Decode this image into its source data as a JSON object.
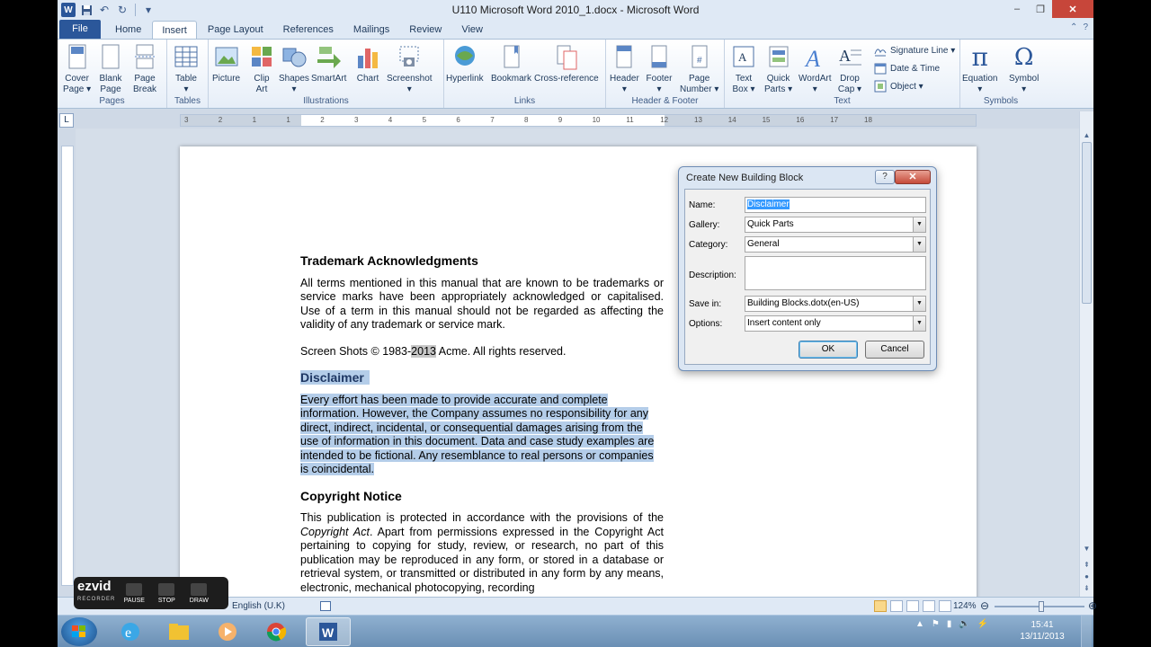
{
  "window": {
    "title": "U110 Microsoft Word 2010_1.docx - Microsoft Word",
    "minimize": "–",
    "restore": "❐",
    "close": "✕"
  },
  "qat": {
    "word": "W",
    "save": "💾",
    "undo": "↶",
    "redo": "↻"
  },
  "tabs": {
    "file": "File",
    "items": [
      "Home",
      "Insert",
      "Page Layout",
      "References",
      "Mailings",
      "Review",
      "View"
    ]
  },
  "ribbon": {
    "pages": {
      "label": "Pages",
      "cover": "Cover\nPage ▾",
      "blank": "Blank\nPage",
      "break": "Page\nBreak"
    },
    "tables": {
      "label": "Tables",
      "table": "Table\n▾"
    },
    "illustrations": {
      "label": "Illustrations",
      "picture": "Picture",
      "clipart": "Clip\nArt",
      "shapes": "Shapes\n▾",
      "smartart": "SmartArt",
      "chart": "Chart",
      "screenshot": "Screenshot\n▾"
    },
    "links": {
      "label": "Links",
      "hyperlink": "Hyperlink",
      "bookmark": "Bookmark",
      "crossref": "Cross-reference"
    },
    "headerfooter": {
      "label": "Header & Footer",
      "header": "Header\n▾",
      "footer": "Footer\n▾",
      "pagenum": "Page\nNumber ▾"
    },
    "text": {
      "label": "Text",
      "textbox": "Text\nBox ▾",
      "quickparts": "Quick\nParts ▾",
      "wordart": "WordArt\n▾",
      "dropcap": "Drop\nCap ▾",
      "sigline": "Signature Line ▾",
      "datetime": "Date & Time",
      "object": "Object ▾"
    },
    "symbols": {
      "label": "Symbols",
      "equation": "Equation\n▾",
      "symbol": "Symbol\n▾"
    }
  },
  "ruler": {
    "tab_selector": "L",
    "numbers": [
      "3",
      "2",
      "1",
      "1",
      "2",
      "3",
      "4",
      "5",
      "6",
      "7",
      "8",
      "9",
      "10",
      "11",
      "12",
      "13",
      "14",
      "15",
      "16",
      "17",
      "18"
    ]
  },
  "document": {
    "h1": "Trademark Acknowledgments",
    "p1": "All terms mentioned in this manual that are known to be trademarks or service marks have been appropriately acknowledged or capitalised.  Use of a term in this manual should not be regarded as affecting the validity of any trademark or service mark.",
    "p2_a": "Screen Shots © 1983-",
    "p2_year": "2013",
    "p2_b": " Acme. All rights reserved.",
    "h2": "Disclaimer",
    "p3": "Every effort has been made to provide accurate and complete information. However, the Company assumes no responsibility for any direct, indirect, incidental, or consequential damages arising from the use of information in this document. Data and case study examples are intended to be fictional. Any resemblance to real persons or companies is coincidental.",
    "h3": "Copyright Notice",
    "p4_a": "This publication is protected in accordance with the provisions of the ",
    "p4_italic": "Copyright Act",
    "p4_b": ". Apart from permissions expressed in the Copyright Act pertaining to copying for study, review, or research, no part of this publication may be reproduced in any form, or stored in a database or retrieval system, or transmitted or distributed in any form by any means, electronic, mechanical photocopying, recording"
  },
  "dialog": {
    "title": "Create New Building Block",
    "help": "?",
    "close": "✕",
    "name_label": "Name:",
    "name_value": "Disclaimer",
    "gallery_label": "Gallery:",
    "gallery_value": "Quick Parts",
    "category_label": "Category:",
    "category_value": "General",
    "description_label": "Description:",
    "description_value": "",
    "savein_label": "Save in:",
    "savein_value": "Building Blocks.dotx(en-US)",
    "options_label": "Options:",
    "options_value": "Insert content only",
    "ok": "OK",
    "cancel": "Cancel"
  },
  "statusbar": {
    "language": "English (U.K)",
    "zoom": "124%",
    "zoom_level": 0.52
  },
  "ezvid": {
    "brand": "ezvid",
    "sub": "RECORDER",
    "pause": "PAUSE",
    "stop": "STOP",
    "draw": "DRAW"
  },
  "clock": {
    "time": "15:41",
    "date": "13/11/2013"
  }
}
